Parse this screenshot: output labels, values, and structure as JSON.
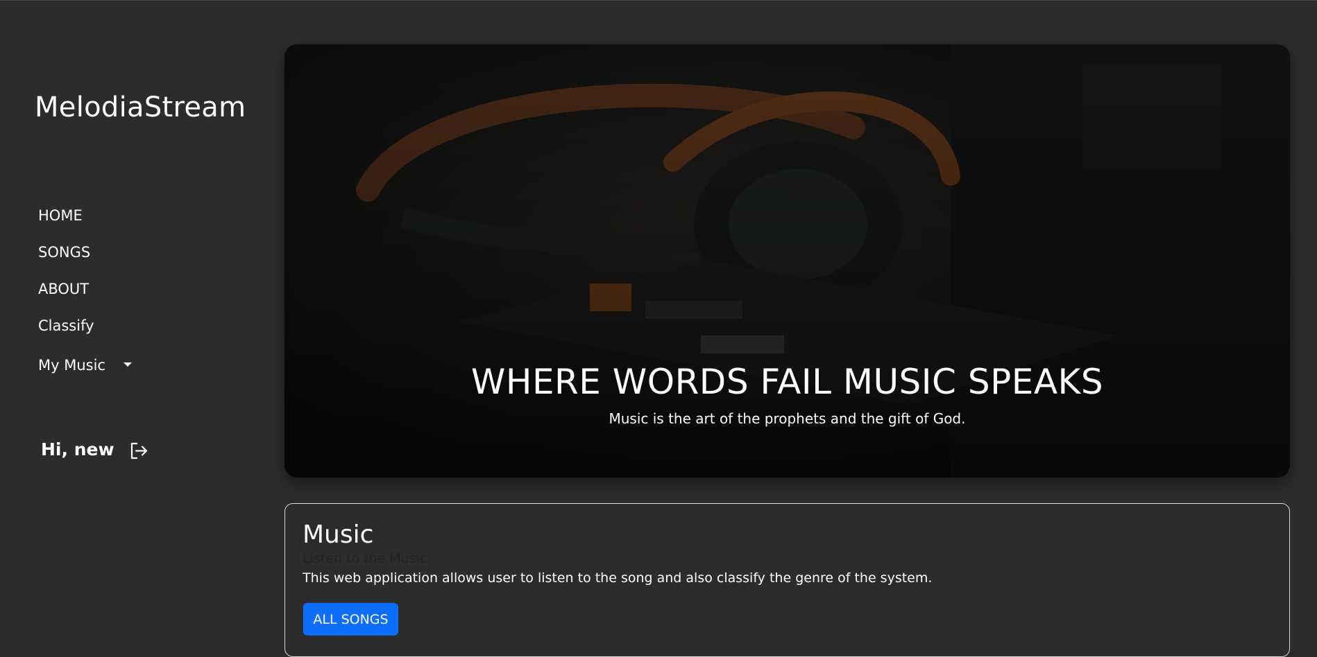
{
  "brand": "MelodiaStream",
  "nav": {
    "home": "HOME",
    "songs": "SONGS",
    "about": "ABOUT",
    "classify": "Classify",
    "my_music": "My Music"
  },
  "user": {
    "greeting": "Hi, new"
  },
  "icons": {
    "logout": "logout-icon",
    "dropdown": "caret-down-icon"
  },
  "hero": {
    "title": "WHERE WORDS FAIL MUSIC SPEAKS",
    "subtitle": "Music is the art of the prophets and the gift of God."
  },
  "card": {
    "title": "Music",
    "subtitle": "Listen to the Music",
    "text": "This web application allows user to listen to the song and also classify the genre of the system.",
    "button": "ALL SONGS"
  },
  "colors": {
    "background": "#2c2c2c",
    "primary_button": "#0d6efd",
    "text": "#ffffff"
  }
}
